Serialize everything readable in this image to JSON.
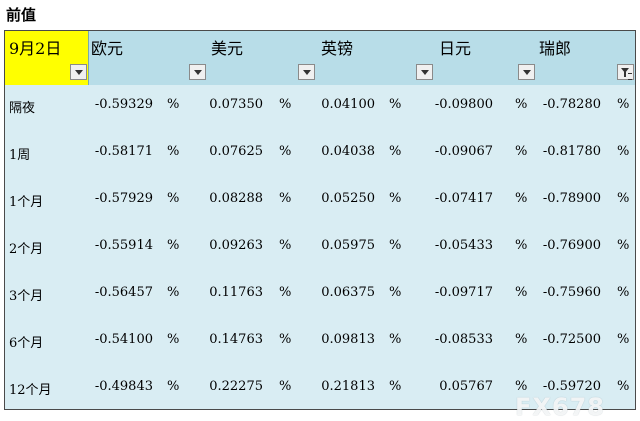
{
  "caption": "前值",
  "date_header": "9月2日",
  "currencies": [
    "欧元",
    "美元",
    "英镑",
    "日元",
    "瑞郎"
  ],
  "percent_sign": "%",
  "rows": [
    {
      "term": "隔夜",
      "values": [
        "-0.59329",
        "0.07350",
        "0.04100",
        "-0.09800",
        "-0.78280"
      ]
    },
    {
      "term": "1周",
      "values": [
        "-0.58171",
        "0.07625",
        "0.04038",
        "-0.09067",
        "-0.81780"
      ]
    },
    {
      "term": "1个月",
      "values": [
        "-0.57929",
        "0.08288",
        "0.05250",
        "-0.07417",
        "-0.78900"
      ]
    },
    {
      "term": "2个月",
      "values": [
        "-0.55914",
        "0.09263",
        "0.05975",
        "-0.05433",
        "-0.76900"
      ]
    },
    {
      "term": "3个月",
      "values": [
        "-0.56457",
        "0.11763",
        "0.06375",
        "-0.09717",
        "-0.75960"
      ]
    },
    {
      "term": "6个月",
      "values": [
        "-0.54100",
        "0.14763",
        "0.09813",
        "-0.08533",
        "-0.72500"
      ]
    },
    {
      "term": "12个月",
      "values": [
        "-0.49843",
        "0.22275",
        "0.21813",
        "0.05767",
        "-0.59720"
      ]
    }
  ],
  "watermark": "FX678",
  "colors": {
    "header_band": "#b8dde8",
    "body": "#d9edf3",
    "date_cell": "#ffff00"
  },
  "icons": [
    "dropdown-arrow-icon",
    "filter-icon"
  ]
}
